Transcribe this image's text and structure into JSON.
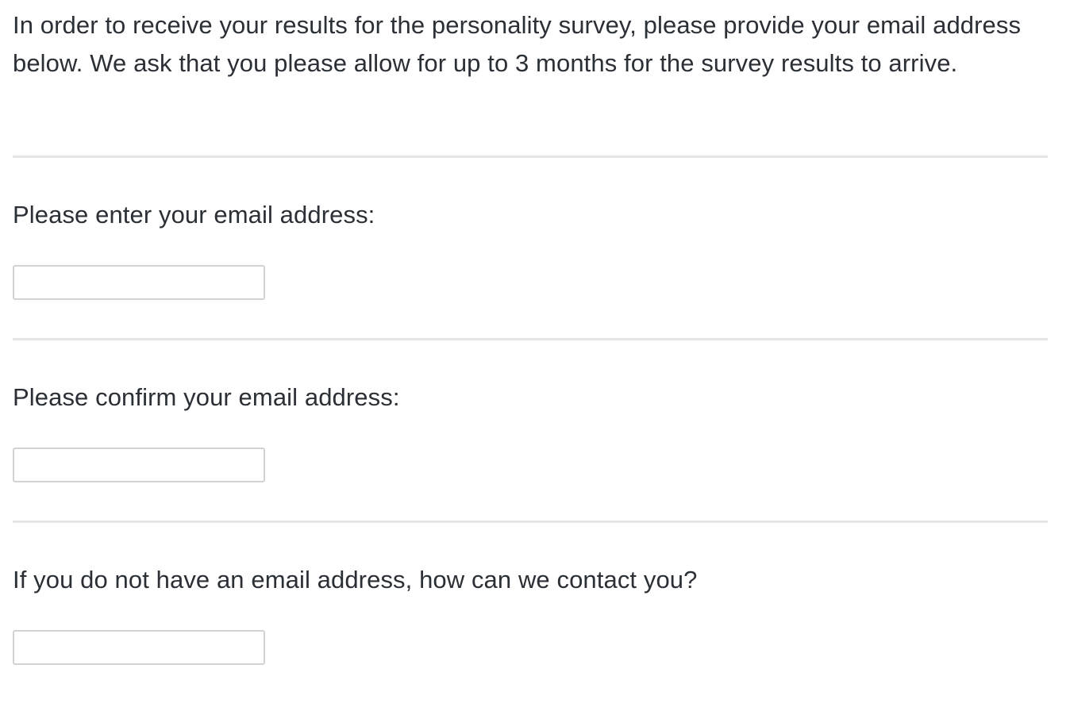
{
  "intro": {
    "text": "In order to receive your results for the personality survey, please provide your email address below. We ask that you please allow for up to 3 months for the survey results to arrive."
  },
  "questions": [
    {
      "label": "Please enter your email address:",
      "value": "",
      "placeholder": ""
    },
    {
      "label": "Please confirm your email address:",
      "value": "",
      "placeholder": ""
    },
    {
      "label": "If you do not have an email address, how can we contact you?",
      "value": "",
      "placeholder": ""
    }
  ],
  "colors": {
    "text": "#2b2f36",
    "divider": "#e6e6e6",
    "input_border": "#d2d2d2",
    "background": "#ffffff"
  }
}
